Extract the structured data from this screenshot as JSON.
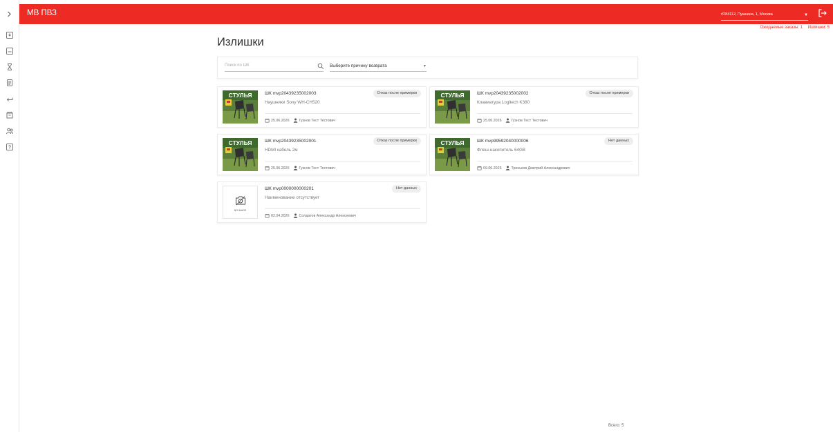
{
  "header": {
    "app_title": "МВ ПВЗ",
    "store_value": "#284112, Пушкина, 1, Москва",
    "pending_orders": "Ожидаемые заказы: 1",
    "surplus_count": "Излишки: 5"
  },
  "page": {
    "title": "Излишки",
    "search_placeholder": "Поиск по ШК",
    "reason_select": "Выберите причину возврата",
    "total": "Всего: 5"
  },
  "cards": [
    {
      "barcode": "ШК mvp20439235002003",
      "name": "Наушники Sony WH-CH520",
      "badge": "Отказ после примерки",
      "date": "25.06.2026",
      "user": "Гузнов Тест Тестович",
      "thumb_text": "СТУЛЬЯ"
    },
    {
      "barcode": "ШК mvp20439235002002",
      "name": "Клавиатура Logitech K380",
      "badge": "Отказ после примерки",
      "date": "25.06.2026",
      "user": "Гузнов Тест Тестович",
      "thumb_text": "СТУЛЬЯ"
    },
    {
      "barcode": "ШК mvp20439235002001",
      "name": "HDMI кабель 2м",
      "badge": "Отказ после примерки",
      "date": "25.06.2026",
      "user": "Гузнов Тест Тестович",
      "thumb_text": "СТУЛЬЯ"
    },
    {
      "barcode": "ШК mvp99592040000006",
      "name": "Флеш-накопитель 64GB",
      "badge": "Нет данных",
      "date": "09.06.2026",
      "user": "Треньков Дмитрий Александрович",
      "thumb_text": "СТУЛЬЯ"
    },
    {
      "barcode": "ШК mvp0000000000201",
      "name": "Наименование отсутствует",
      "badge": "Нет данных",
      "date": "02.04.2026",
      "user": "Солдатов Александр Алексеевич",
      "thumb_text": "NO IMAGE"
    }
  ],
  "icons": {
    "sidebar": [
      "chevron-right-icon",
      "inbox-in-icon",
      "inbox-out-icon",
      "hourglass-icon",
      "document-icon",
      "return-arrow-icon",
      "surplus-box-icon",
      "users-icon",
      "help-icon"
    ],
    "header": [
      "dropdown-arrow-icon",
      "logout-icon"
    ]
  },
  "colors": {
    "brand_red": "#ee2a24"
  }
}
